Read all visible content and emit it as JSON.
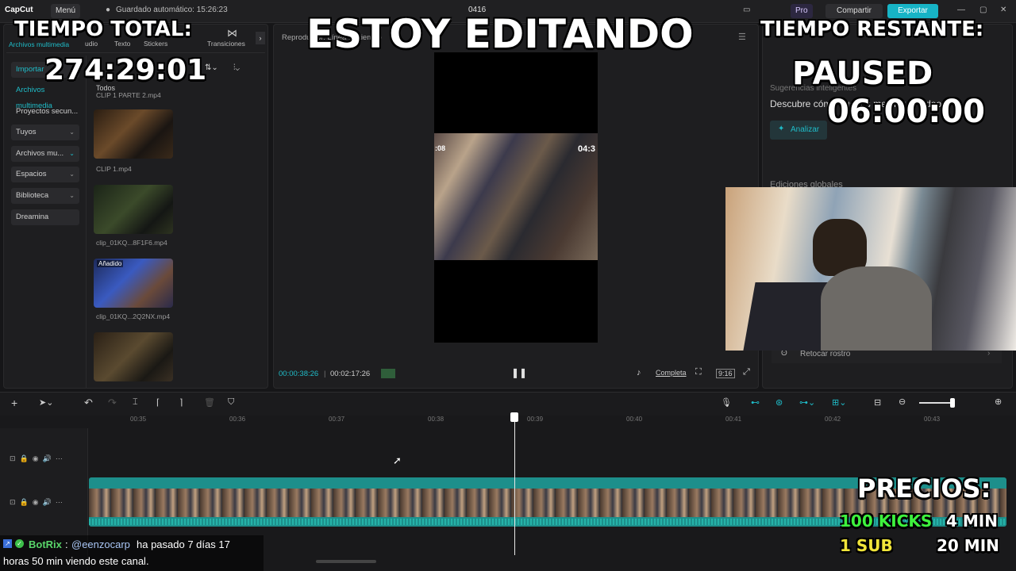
{
  "app": {
    "logo": "CapCut",
    "menu": "Menú",
    "autosave": "Guardado automático: 15:26:23",
    "project": "0416",
    "pro": "Pro",
    "share": "Compartir",
    "export": "Exportar"
  },
  "media_tabs": [
    "udio",
    "Texto",
    "Stickers",
    "Transiciones"
  ],
  "left_nav": {
    "tab_active": "Archivos multimedia",
    "items": [
      {
        "label": "Importar",
        "chev": false
      },
      {
        "label": "Archivos multimedia",
        "chev": false
      },
      {
        "label": "Proyectos secun...",
        "chev": false
      },
      {
        "label": "Tuyos",
        "chev": true
      },
      {
        "label": "Archivos mu...",
        "chev": true
      },
      {
        "label": "Espacios",
        "chev": true
      },
      {
        "label": "Biblioteca",
        "chev": true
      },
      {
        "label": "Dreamina",
        "chev": false
      }
    ]
  },
  "media": {
    "header": "Todos",
    "clips": [
      {
        "name": "CLIP 1 PARTE 2.mp4"
      },
      {
        "name": "CLIP 1.mp4"
      },
      {
        "name": "clip_01KQ...8F1F6.mp4"
      },
      {
        "name": "clip_01KQ...2Q2NX.mp4",
        "badge": "Añadido"
      },
      {
        "name": ""
      }
    ]
  },
  "player": {
    "title": "Reproductor: Línea de tiempo",
    "time_current": "00:00:38:26",
    "time_total": "00:02:17:26",
    "ratio_label": "Completa",
    "aspect": "9:16",
    "clip_overlay_left": ":08",
    "clip_overlay_right": "04:3"
  },
  "right_panel": {
    "suggestions_title": "Sugerencias inteligentes",
    "suggestions_text": "Descubre cómo puedes mejorar tu video",
    "analyze_button": "Analizar",
    "global_edits": "Ediciones globales",
    "retouch": "Retocar rostro"
  },
  "timeline": {
    "ticks": [
      "00:35",
      "00:36",
      "00:37",
      "00:38",
      "00:39",
      "00:40",
      "00:41",
      "00:42",
      "00:43"
    ]
  },
  "overlay": {
    "total_title": "TIEMPO TOTAL:",
    "total_time": "274:29:01",
    "headline": "ESTOY EDITANDO",
    "remaining_title": "TIEMPO RESTANTE:",
    "paused": "PAUSED",
    "remaining_time": "06:00:00",
    "prices_title": "PRECIOS:",
    "price1_label": "100 KICKS",
    "price1_value": "4 MIN",
    "price2_label": "1 SUB",
    "price2_value": "20 MIN"
  },
  "chat": {
    "user": "BotRix",
    "separator": ":",
    "mention": "@eenzocarp",
    "message_a": "ha pasado 7 días 17",
    "message_b": "horas 50 min viendo este canal."
  },
  "colors": {
    "accent": "#1fbcc8",
    "export": "#17b4c6",
    "timeline_clip": "#1d8f8b",
    "green_price": "#3df23d",
    "yellow_price": "#f1e53a"
  }
}
